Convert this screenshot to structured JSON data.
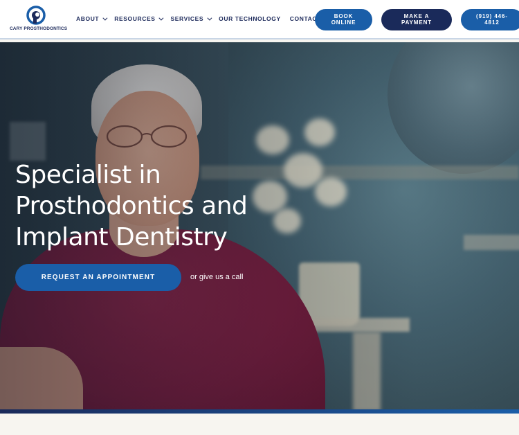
{
  "brand": {
    "name": "CARY PROSTHODONTICS",
    "colors": {
      "navy": "#1d2a5b",
      "blue": "#1a5ea8",
      "dark_button": "#1a2a5a"
    }
  },
  "nav": {
    "items": [
      {
        "label": "ABOUT",
        "has_dropdown": true
      },
      {
        "label": "RESOURCES",
        "has_dropdown": true
      },
      {
        "label": "SERVICES",
        "has_dropdown": true
      },
      {
        "label": "OUR TECHNOLOGY",
        "has_dropdown": false
      },
      {
        "label": "CONTACT",
        "has_dropdown": false
      }
    ]
  },
  "buttons": {
    "book_line1": "BOOK",
    "book_line2": "ONLINE",
    "pay_line1": "MAKE A",
    "pay_line2": "PAYMENT",
    "phone_line1": "(919) 446-",
    "phone_line2": "4812"
  },
  "hero": {
    "headline_lines": [
      "Specialist in",
      "Prosthodontics and",
      "Implant Dentistry"
    ],
    "cta_label": "REQUEST AN APPOINTMENT",
    "call_text": "or give us a call"
  }
}
